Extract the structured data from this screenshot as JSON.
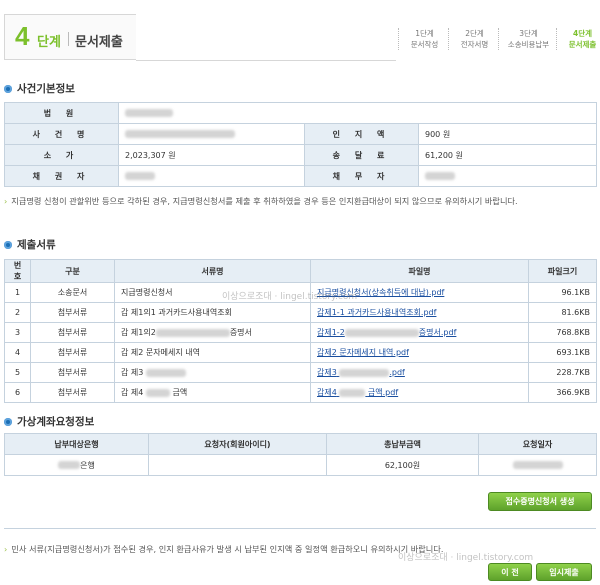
{
  "header": {
    "step_number": "4",
    "step_word": "단계",
    "step_title": "문서제출",
    "steps": [
      {
        "line1": "1단계",
        "line2": "문서작성",
        "active": false
      },
      {
        "line1": "2단계",
        "line2": "전자서명",
        "active": false
      },
      {
        "line1": "3단계",
        "line2": "소송비용납부",
        "active": false
      },
      {
        "line1": "4단계",
        "line2": "문서제출",
        "active": true
      }
    ]
  },
  "case_info": {
    "title": "사건기본정보",
    "labels": {
      "court": "법 원",
      "case_name": "사 건 명",
      "stamp_fee": "인 지 액",
      "claim_value": "소 가",
      "delivery_fee": "송 달 료",
      "creditor": "채 권 자",
      "debtor": "채 무 자"
    },
    "values": {
      "stamp_fee": "900 원",
      "claim_value": "2,023,307 원",
      "delivery_fee": "61,200 원"
    },
    "note": "지급명령 신청이 관할위반 등으로 각하된 경우, 지급명령신청서를 제출 후 취하하였을 경우 등은 인지환급대상이 되지 않으므로 유의하시기 바랍니다."
  },
  "documents": {
    "title": "제출서류",
    "columns": [
      "번호",
      "구분",
      "서류명",
      "파일명",
      "파일크기"
    ],
    "rows": [
      {
        "no": "1",
        "type": "소송문서",
        "name": "지급명령신청서",
        "file": "지급명령신청서(상속취득에 대납).pdf",
        "size": "96.1KB"
      },
      {
        "no": "2",
        "type": "첨부서류",
        "name": "갑 제1의1 과거카드사용내역조회",
        "file": "갑제1-1 과거카드사용내역조회.pdf",
        "size": "81.6KB"
      },
      {
        "no": "3",
        "type": "첨부서류",
        "name": "갑 제1의2",
        "name_suffix": "증명서",
        "file": "갑제1-2",
        "file_suffix": "증명서.pdf",
        "size": "768.8KB"
      },
      {
        "no": "4",
        "type": "첨부서류",
        "name": "갑 제2 문자메세지 내역",
        "file": "갑제2 문자메세지 내역.pdf",
        "size": "693.1KB"
      },
      {
        "no": "5",
        "type": "첨부서류",
        "name": "갑 제3",
        "name_suffix": "",
        "file": "갑제3",
        "file_suffix": ".pdf",
        "size": "228.7KB"
      },
      {
        "no": "6",
        "type": "첨부서류",
        "name": "갑 제4",
        "name_suffix": "금액",
        "file": "갑제4",
        "file_suffix": "금액.pdf",
        "size": "366.9KB"
      }
    ]
  },
  "virtual_account": {
    "title": "가상계좌요청정보",
    "columns": [
      "납부대상은행",
      "요청자(회원아이디)",
      "총납부금액",
      "요청일자"
    ],
    "row": {
      "bank_suffix": "은행",
      "amount": "62,100원"
    }
  },
  "buttons": {
    "receipt": "접수증명신청서 생성",
    "prev": "이 전",
    "temp_submit": "임시제출"
  },
  "bottom_note": "민사 서류(지급명령신청서)가 접수된 경우, 인지 환급사유가 발생 시 납부된 인지액 중 일정액 환급하오니 유의하시기 바랍니다.",
  "watermarks": {
    "mid": "이상으로조대 · lingel.tistory.com",
    "bottom": "이상으로조대 · lingel.tistory.com"
  },
  "colors": {
    "accent": "#7cc02c",
    "header_bg": "#e6eef5",
    "link": "#1a4fa0"
  }
}
